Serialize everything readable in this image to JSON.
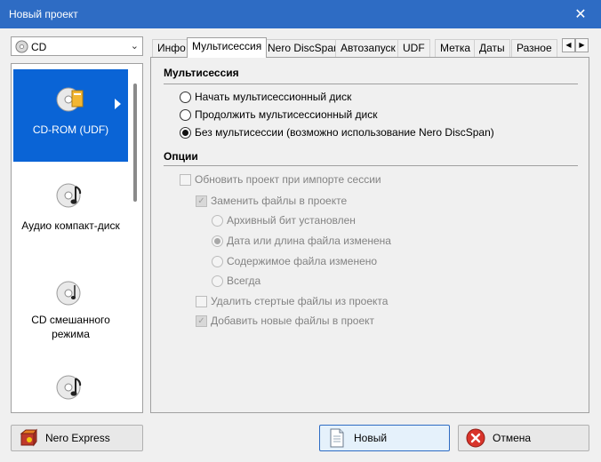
{
  "window": {
    "title": "Новый проект",
    "close_glyph": "✕"
  },
  "media_select": {
    "value": "CD",
    "icon": "cd-disc-icon"
  },
  "project_types": [
    {
      "label": "CD-ROM (UDF)",
      "icon": "cdrom-disc-icon",
      "selected": true
    },
    {
      "label": "Аудио компакт-диск",
      "icon": "audio-disc-icon",
      "selected": false
    },
    {
      "label_line1": "CD смешанного",
      "label_line2": "режима",
      "icon": "mixed-mode-disc-icon",
      "selected": false
    },
    {
      "label": "",
      "icon": "audio-disc-icon",
      "selected": false
    }
  ],
  "tabs": [
    "Инфо",
    "Мультисессия",
    "Nero DiscSpan",
    "Автозапуск",
    "UDF",
    "Метка",
    "Даты",
    "Разное"
  ],
  "active_tab": "Мультисессия",
  "multisession": {
    "heading": "Мультисессия",
    "options": [
      {
        "label": "Начать мультисессионный диск",
        "checked": false
      },
      {
        "label": "Продолжить мультисессионный диск",
        "checked": false
      },
      {
        "label": "Без мультисессии (возможно использование Nero DiscSpan)",
        "checked": true
      }
    ]
  },
  "options_section": {
    "heading": "Опции",
    "update_on_import": "Обновить проект при импорте сессии",
    "replace_files": "Заменить файлы в проекте",
    "replace_criteria": [
      {
        "label": "Архивный бит установлен",
        "checked": false
      },
      {
        "label": "Дата или длина файла изменена",
        "checked": true
      },
      {
        "label": "Содержимое файла изменено",
        "checked": false
      },
      {
        "label": "Всегда",
        "checked": false
      }
    ],
    "delete_removed": "Удалить стертые файлы из проекта",
    "add_new": "Добавить новые файлы в проект"
  },
  "buttons": {
    "nero_express": "Nero Express",
    "new": "Новый",
    "cancel": "Отмена"
  },
  "colors": {
    "titlebar": "#2e6cc4",
    "selection": "#0a64d6",
    "cancel_red": "#d9342b"
  }
}
